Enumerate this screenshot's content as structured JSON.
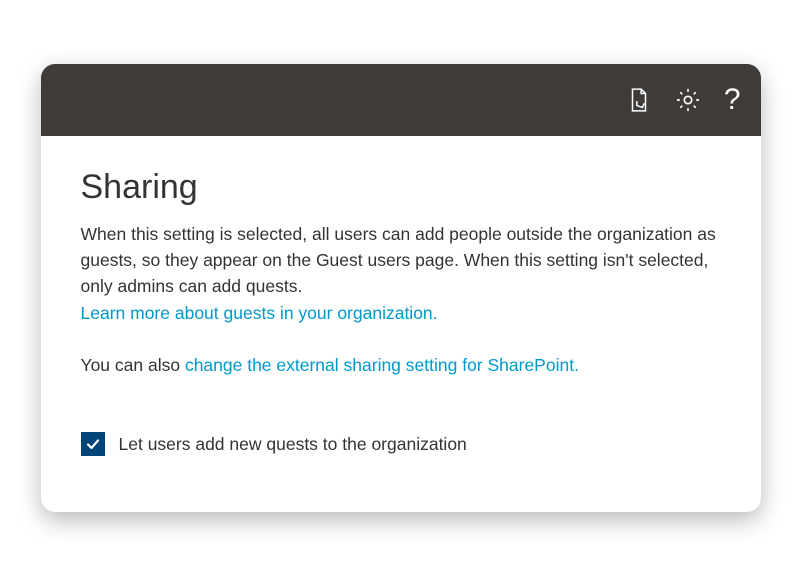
{
  "page_title": "Sharing",
  "description": "When this setting is selected, all users can add people outside the organization as guests, so they appear on the Guest users page. When this setting isn't selected, only admins can add quests.",
  "learn_more_link": "Learn more about guests in your organization.",
  "second_para_prefix": "You can also ",
  "sharepoint_link": "change the external sharing setting for SharePoint.",
  "checkbox": {
    "checked": true,
    "label": "Let users add new quests to the organization"
  },
  "icons": {
    "doc": "document-touch-icon",
    "settings": "gear-icon",
    "help": "help-icon"
  }
}
